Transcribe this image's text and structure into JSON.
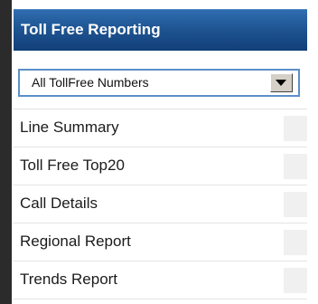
{
  "panel": {
    "title": "Toll Free Reporting"
  },
  "filter": {
    "selected_value": "All TollFree Numbers"
  },
  "menu": {
    "items": [
      {
        "label": "Line Summary"
      },
      {
        "label": "Toll Free Top20"
      },
      {
        "label": "Call Details"
      },
      {
        "label": "Regional Report"
      },
      {
        "label": "Trends Report"
      }
    ]
  },
  "colors": {
    "header": "#1f5593",
    "left_rail": "#2b2b2b",
    "select_border": "#5b8fc9"
  }
}
